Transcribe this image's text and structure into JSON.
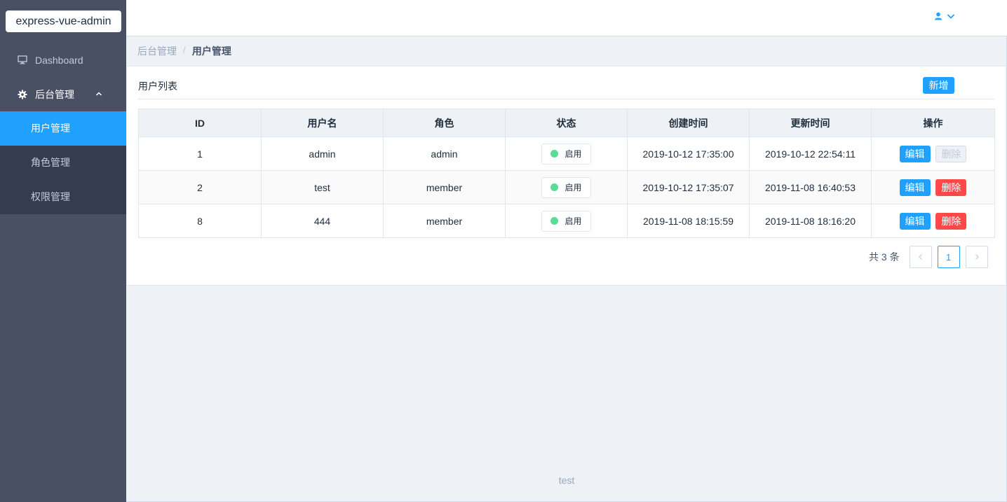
{
  "sidebar": {
    "logo": "express-vue-admin",
    "dashboard": {
      "label": "Dashboard",
      "icon": "monitor-icon"
    },
    "admin_group": {
      "label": "后台管理",
      "icon": "gear-icon",
      "expanded": true
    },
    "sub_items": [
      {
        "label": "用户管理",
        "active": true
      },
      {
        "label": "角色管理",
        "active": false
      },
      {
        "label": "权限管理",
        "active": false
      }
    ]
  },
  "header": {
    "user_icon": "user-icon",
    "dropdown_icon": "chevron-down-icon"
  },
  "breadcrumb": {
    "items": [
      "后台管理",
      "用户管理"
    ],
    "separator": "/"
  },
  "card": {
    "title": "用户列表",
    "add_label": "新增",
    "table": {
      "columns": [
        "ID",
        "用户名",
        "角色",
        "状态",
        "创建时间",
        "更新时间",
        "操作"
      ],
      "rows": [
        {
          "id": "1",
          "username": "admin",
          "role": "admin",
          "status": "启用",
          "created": "2019-10-12 17:35:00",
          "updated": "2019-10-12 22:54:11",
          "delete_disabled": true
        },
        {
          "id": "2",
          "username": "test",
          "role": "member",
          "status": "启用",
          "created": "2019-10-12 17:35:07",
          "updated": "2019-11-08 16:40:53",
          "delete_disabled": false
        },
        {
          "id": "8",
          "username": "444",
          "role": "member",
          "status": "启用",
          "created": "2019-11-08 18:15:59",
          "updated": "2019-11-08 18:16:20",
          "delete_disabled": false
        }
      ],
      "edit_label": "编辑",
      "delete_label": "删除"
    },
    "pagination": {
      "total_text": "共 3 条",
      "current_page": "1",
      "prev_icon": "chevron-left-icon",
      "next_icon": "chevron-right-icon"
    }
  },
  "footer": {
    "text": "test"
  },
  "colors": {
    "primary": "#20a0ff",
    "danger": "#ff4949",
    "success": "#13ce66",
    "sidebar_bg": "#4a5064",
    "submenu_bg": "#363c4f"
  }
}
